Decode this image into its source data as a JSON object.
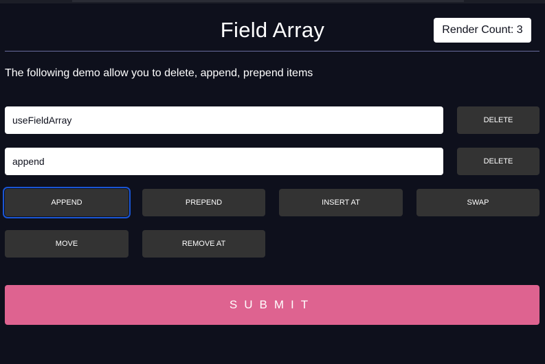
{
  "header": {
    "title": "Field Array",
    "render_count": "Render Count: 3"
  },
  "description": "The following demo allow you to delete, append, prepend items",
  "fields": [
    {
      "value": "useFieldArray",
      "delete_label": "DELETE"
    },
    {
      "value": "append",
      "delete_label": "DELETE"
    }
  ],
  "actions": {
    "append": "APPEND",
    "prepend": "PREPEND",
    "insert_at": "INSERT AT",
    "swap": "SWAP",
    "move": "MOVE",
    "remove_at": "REMOVE AT"
  },
  "submit_label": "SUBMIT",
  "colors": {
    "background": "#0e101c",
    "button": "#333333",
    "submit": "#de6390",
    "focus_ring": "#1a56d6",
    "divider": "#6a6d9e"
  }
}
